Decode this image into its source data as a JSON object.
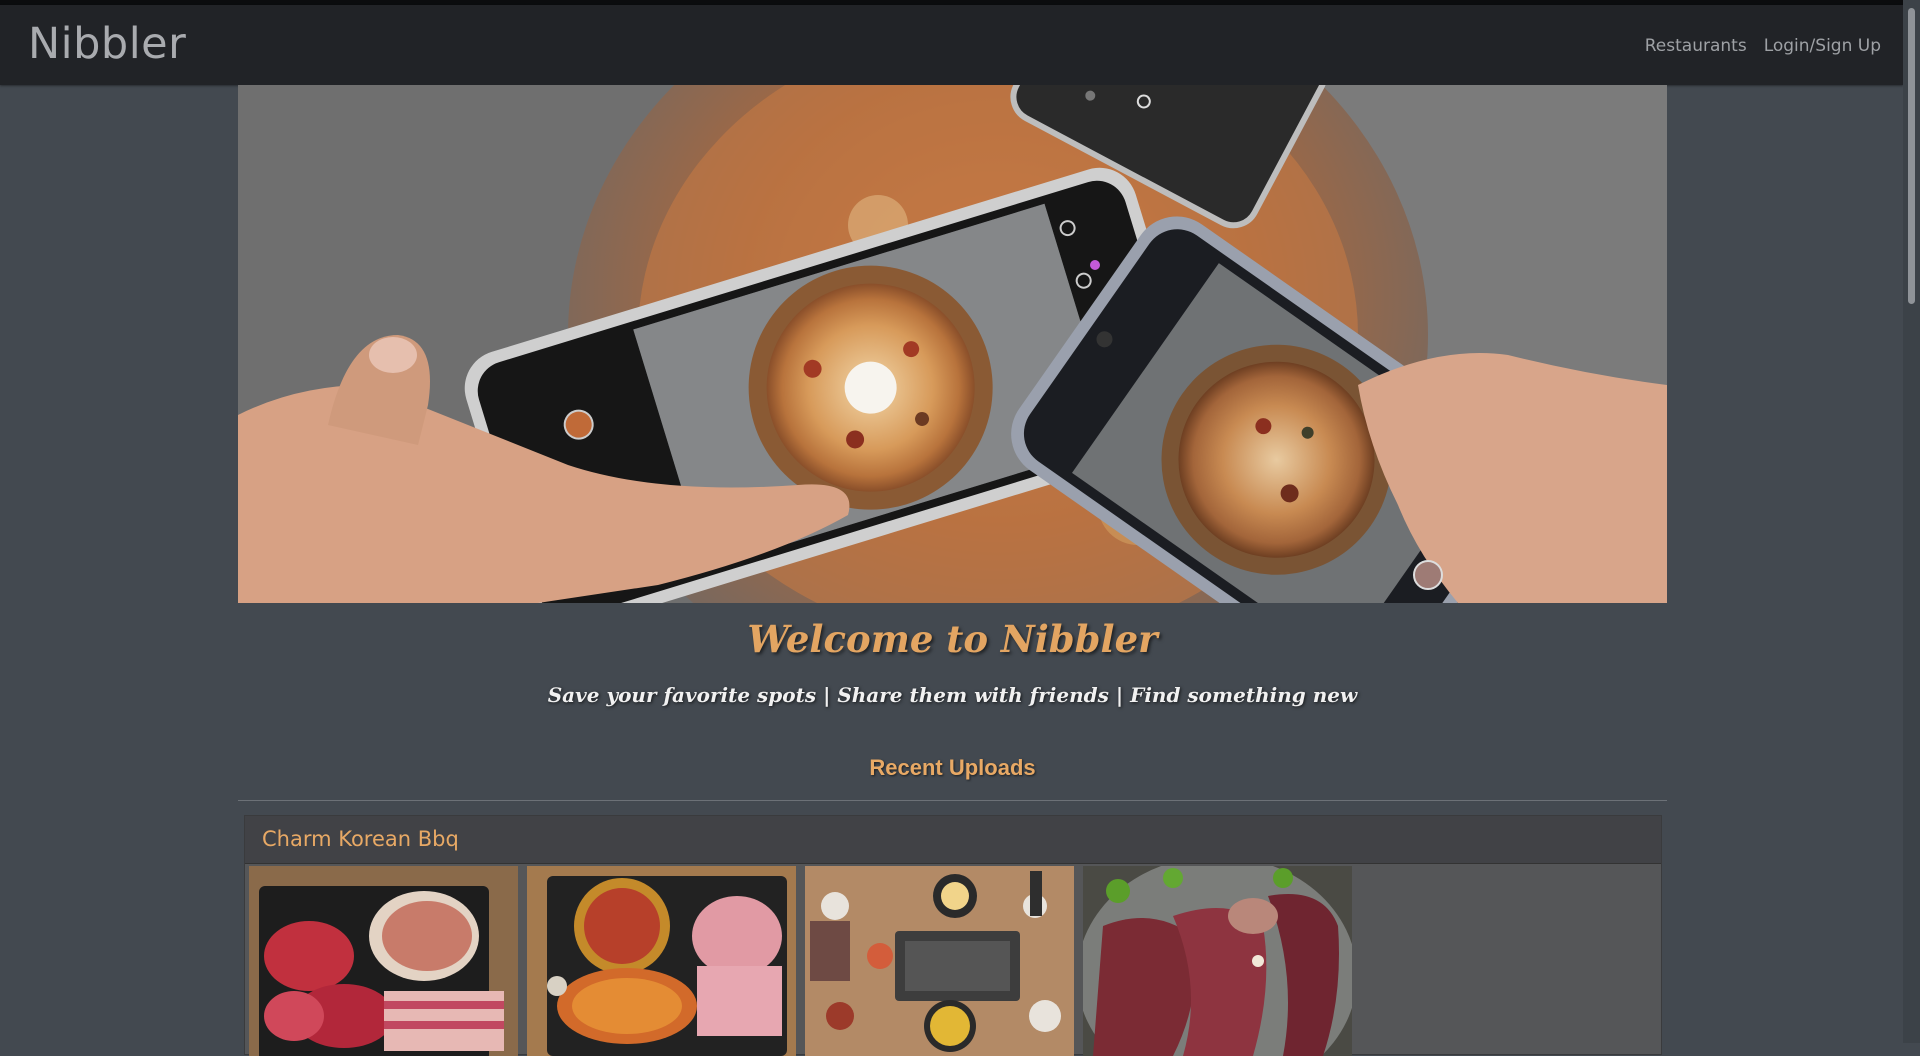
{
  "navbar": {
    "brand": "Nibbler",
    "links": [
      {
        "label": "Restaurants"
      },
      {
        "label": "Login/Sign Up"
      }
    ]
  },
  "hero": {
    "image": "hero-photo-pizza-phones"
  },
  "welcome": {
    "title": "Welcome to Nibbler",
    "tagline": "Save your favorite spots | Share them with friends | Find something new"
  },
  "recent": {
    "heading": "Recent Uploads",
    "restaurants": [
      {
        "name": "Charm Korean Bbq",
        "photos": [
          "raw-meat-platter",
          "marinated-meat-platter",
          "grill-table-spread",
          "grilled-ribs"
        ]
      }
    ]
  },
  "colors": {
    "background": "#434950",
    "navbar": "#212327",
    "accent": "#e3a562",
    "card": "#555658"
  }
}
